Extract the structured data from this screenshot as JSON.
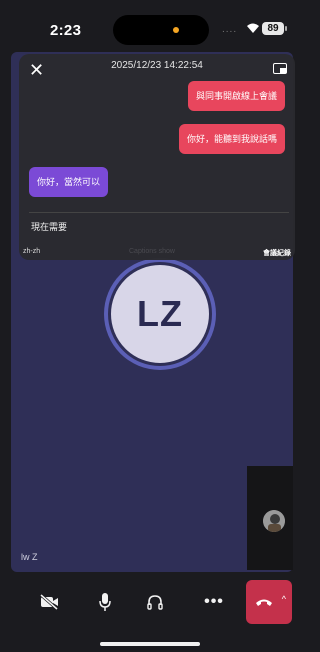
{
  "status_bar": {
    "time": "2:23",
    "signal": "....",
    "battery": "89"
  },
  "caption_panel": {
    "timestamp": "2025/12/23 14:22:54",
    "messages": [
      {
        "text": "與同事開啟線上會議",
        "side": "outgoing"
      },
      {
        "text": "你好，能聽到我說話嗎",
        "side": "outgoing"
      },
      {
        "text": "你好，當然可以",
        "side": "incoming"
      }
    ],
    "draft_text": "現在需要",
    "language": "zh-zh",
    "ghost_text": "Captions show",
    "record_label": "會議紀錄"
  },
  "call": {
    "initials": "LZ",
    "participant_name": "lw Z"
  },
  "colors": {
    "outgoing_bubble": "#e8465d",
    "incoming_bubble": "#7b4ad6",
    "call_background": "#2f2f57",
    "end_call": "#c4314b"
  },
  "controls": {
    "camera_icon": "camera-off-icon",
    "mic_icon": "microphone-icon",
    "audio_icon": "headphones-icon",
    "more_label": "•••",
    "end_icon": "phone-hangup-icon",
    "chevron": "^"
  }
}
